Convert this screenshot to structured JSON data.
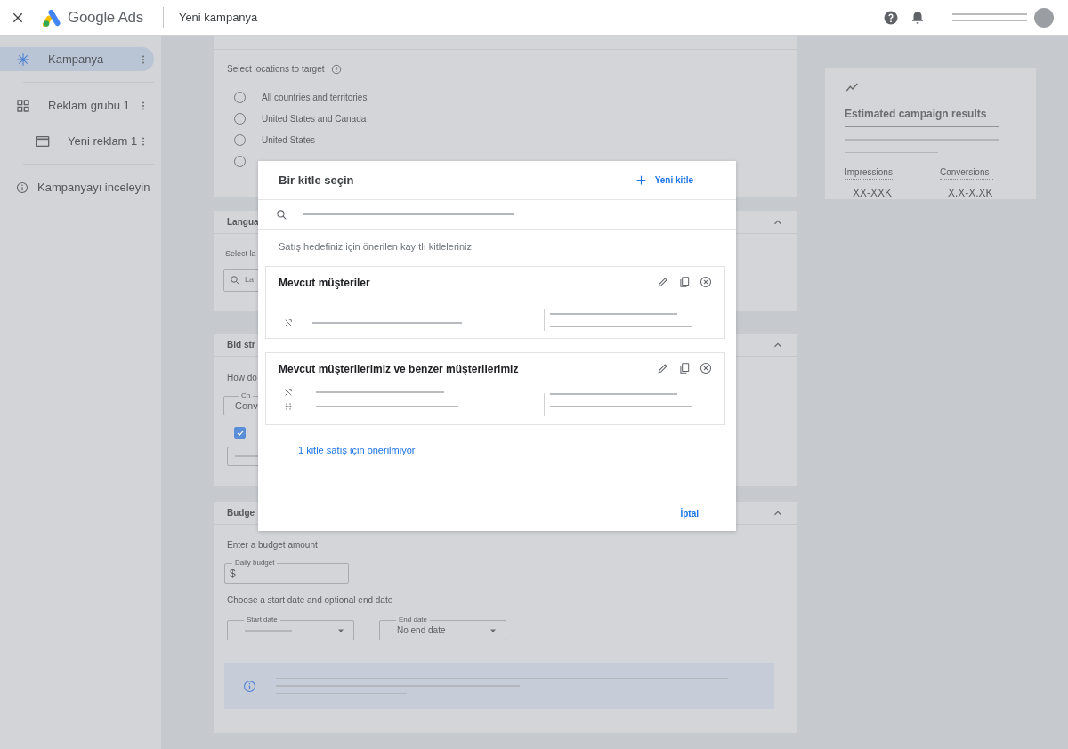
{
  "header": {
    "product": "Google Ads",
    "title": "Yeni kampanya"
  },
  "sidebar": {
    "items": [
      {
        "label": "Kampanya",
        "kind": "campaign",
        "selected": true
      },
      {
        "label": "Reklam grubu 1",
        "kind": "ad_group",
        "selected": false,
        "children": [
          {
            "label": "Yeni reklam 1",
            "kind": "ad",
            "selected": false
          }
        ]
      },
      {
        "label": "Kampanyayı inceleyin",
        "kind": "review",
        "selected": false
      }
    ]
  },
  "locations": {
    "label": "Select locations to target",
    "options": [
      {
        "label": "All countries and territories",
        "selected": false
      },
      {
        "label": "United States and Canada",
        "selected": false
      },
      {
        "label": "United States",
        "selected": false
      },
      {
        "selected": false
      }
    ]
  },
  "language": {
    "title": "Langua",
    "expanded": true,
    "label": "Select la",
    "placeholder": "La"
  },
  "bid_strategy": {
    "title": "Bid str",
    "expanded": true,
    "question": "How do",
    "field": {
      "label": "Ch",
      "value": "Conv"
    },
    "checkbox": {
      "checked": true
    }
  },
  "budget": {
    "title": "Budge",
    "expanded": true,
    "prompt": "Enter a budget amount",
    "daily_budget": {
      "label": "Daily budget",
      "prefix": "$"
    },
    "dates_prompt": "Choose a start date and optional end date",
    "start_date": {
      "label": "Start date"
    },
    "end_date": {
      "label": "End date",
      "value": "No end date"
    }
  },
  "results": {
    "title": "Estimated campaign results",
    "metrics": [
      {
        "label": "Impressions",
        "value": "XX-XXK"
      },
      {
        "label": "Conversions",
        "value": "X.X-X.XK"
      }
    ]
  },
  "dialog": {
    "title": "Bir kitle seçin",
    "new_button": "Yeni kitle",
    "hint": "Satış hedefiniz için önerilen kayıtlı kitleleriniz",
    "audiences": [
      {
        "name": "Mevcut müşteriler",
        "segments": [
          {
            "kind": "mixed"
          }
        ]
      },
      {
        "name": "Mevcut müşterilerimiz ve benzer müşterilerimiz",
        "segments": [
          {
            "kind": "mixed"
          },
          {
            "kind": "merged"
          }
        ]
      }
    ],
    "link": "1 kitle satış için önerilmiyor",
    "cancel": "İptal"
  }
}
